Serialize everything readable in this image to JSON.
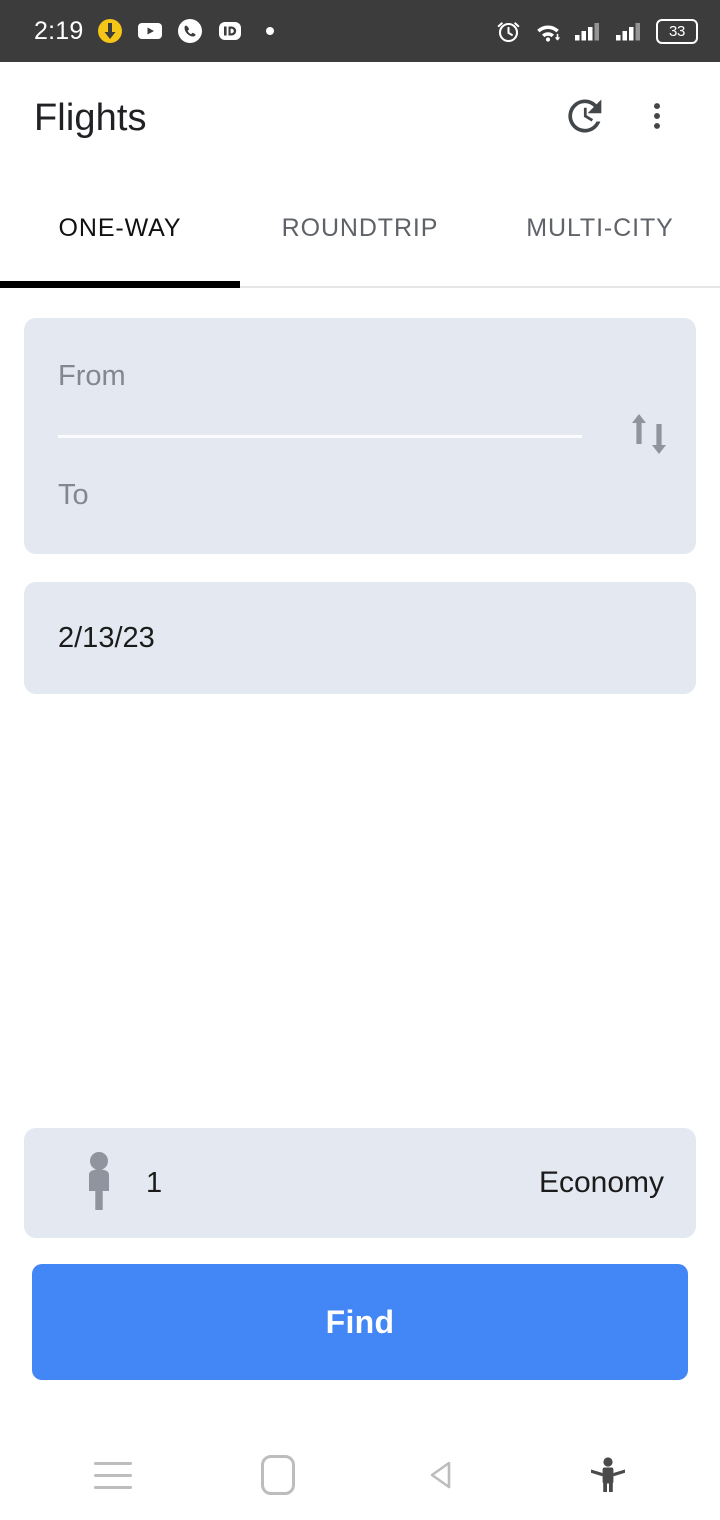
{
  "status_bar": {
    "time": "2:19",
    "notifications": [
      {
        "name": "download-icon",
        "label": "download"
      },
      {
        "name": "youtube-icon",
        "label": "YouTube"
      },
      {
        "name": "phone-icon",
        "label": "Phone"
      },
      {
        "name": "id-app-icon",
        "label": "iD"
      },
      {
        "name": "more-notifications-dot",
        "label": "•"
      }
    ],
    "system_icons": [
      {
        "name": "alarm-icon",
        "label": "Alarm set"
      },
      {
        "name": "wifi-icon",
        "label": "Wi-Fi"
      },
      {
        "name": "signal-sim1-icon",
        "label": "Signal SIM 1"
      },
      {
        "name": "signal-sim2-icon",
        "label": "Signal SIM 2"
      }
    ],
    "battery_level": "33",
    "background_color": "#3c3c3c"
  },
  "app_bar": {
    "title": "Flights",
    "actions": [
      {
        "name": "history-icon",
        "label": "History"
      },
      {
        "name": "overflow-menu-icon",
        "label": "More options"
      }
    ]
  },
  "tabs": {
    "items": [
      {
        "label": "ONE-WAY",
        "selected": true
      },
      {
        "label": "ROUNDTRIP",
        "selected": false
      },
      {
        "label": "MULTI-CITY",
        "selected": false
      }
    ],
    "indicator_color": "#000000"
  },
  "search_form": {
    "from": {
      "value": "",
      "placeholder": "From"
    },
    "to": {
      "value": "",
      "placeholder": "To"
    },
    "swap_button_label": "Swap origin and destination",
    "date": {
      "value": "2/13/23"
    },
    "passengers": {
      "count": "1",
      "icon": "person-icon"
    },
    "cabin_class": "Economy",
    "submit_label": "Find",
    "card_background": "#e4e8f1",
    "submit_color": "#4287f5"
  },
  "nav_bar": {
    "buttons": [
      {
        "name": "recents-button",
        "label": "Recents"
      },
      {
        "name": "home-button",
        "label": "Home"
      },
      {
        "name": "back-button",
        "label": "Back"
      },
      {
        "name": "accessibility-button",
        "label": "Accessibility"
      }
    ]
  }
}
